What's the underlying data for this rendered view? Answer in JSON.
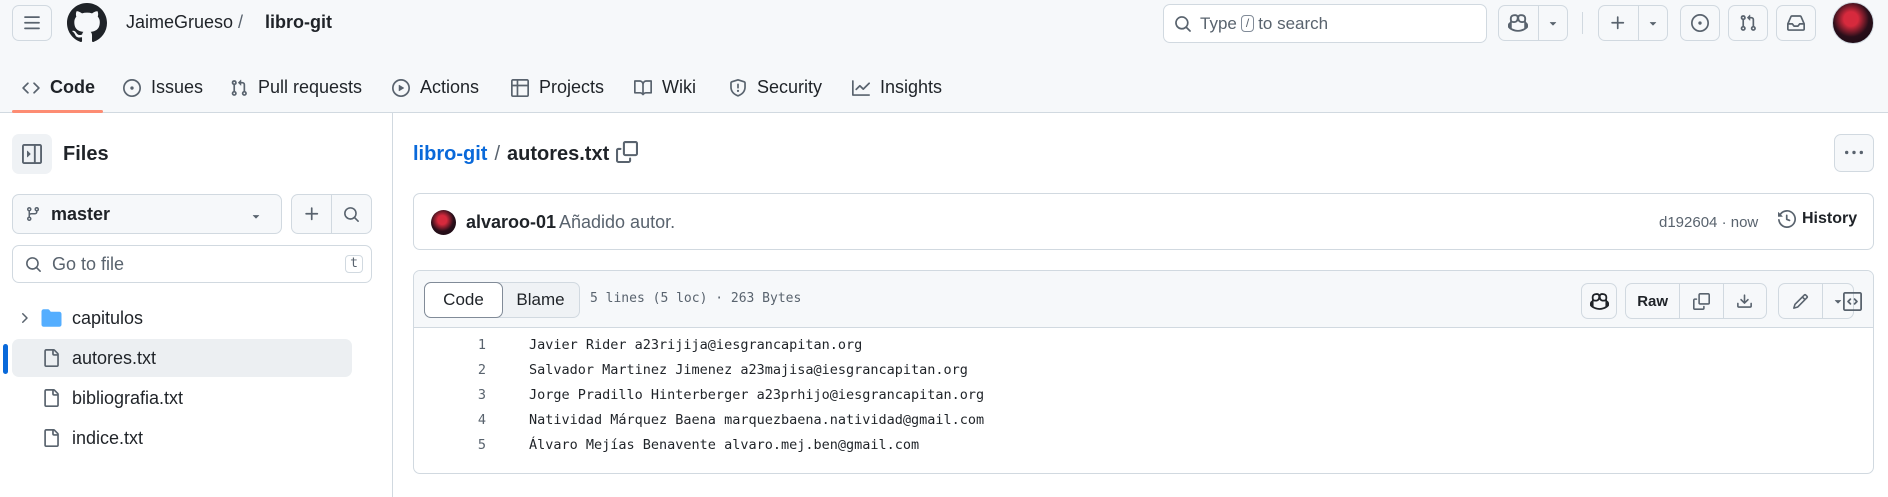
{
  "header": {
    "owner": "JaimeGrueso",
    "separator": "/",
    "repo": "libro-git",
    "search": {
      "before": "Type",
      "key": "/",
      "after": "to search"
    }
  },
  "nav": {
    "tabs": [
      {
        "id": "code",
        "label": "Code",
        "icon": "code-icon",
        "selected": true
      },
      {
        "id": "issues",
        "label": "Issues",
        "icon": "issue-opened-icon"
      },
      {
        "id": "pulls",
        "label": "Pull requests",
        "icon": "git-pull-request-icon"
      },
      {
        "id": "actions",
        "label": "Actions",
        "icon": "play-icon"
      },
      {
        "id": "projects",
        "label": "Projects",
        "icon": "table-icon"
      },
      {
        "id": "wiki",
        "label": "Wiki",
        "icon": "book-icon"
      },
      {
        "id": "security",
        "label": "Security",
        "icon": "shield-icon"
      },
      {
        "id": "insights",
        "label": "Insights",
        "icon": "graph-icon"
      }
    ]
  },
  "sidebar": {
    "title": "Files",
    "branch": "master",
    "goto_placeholder": "Go to file",
    "goto_key": "t",
    "tree": [
      {
        "name": "capitulos",
        "type": "folder"
      },
      {
        "name": "autores.txt",
        "type": "file",
        "active": true
      },
      {
        "name": "bibliografia.txt",
        "type": "file"
      },
      {
        "name": "indice.txt",
        "type": "file"
      }
    ]
  },
  "main": {
    "path_repo": "libro-git",
    "path_sep": "/",
    "path_file": "autores.txt",
    "commit": {
      "author": "alvaroo-01",
      "message": "Añadido autor.",
      "meta": "d192604 · now",
      "history_label": "History"
    },
    "file": {
      "tab_code": "Code",
      "tab_blame": "Blame",
      "info": "5 lines (5 loc) · 263 Bytes",
      "raw_label": "Raw",
      "lines": [
        {
          "n": "1",
          "text": "Javier Rider a23rijija@iesgrancapitan.org"
        },
        {
          "n": "2",
          "text": "Salvador Martinez Jimenez a23majisa@iesgrancapitan.org"
        },
        {
          "n": "3",
          "text": "Jorge Pradillo Hinterberger a23prhijo@iesgrancapitan.org"
        },
        {
          "n": "4",
          "text": "Natividad Márquez Baena marquezbaena.natividad@gmail.com"
        },
        {
          "n": "5",
          "text": "Álvaro Mejías Benavente alvaro.mej.ben@gmail.com"
        }
      ]
    }
  },
  "colors": {
    "accent_link": "#0969da",
    "tab_underline": "#fd8c73",
    "border": "#d1d9e0",
    "muted_text": "#59636e"
  }
}
